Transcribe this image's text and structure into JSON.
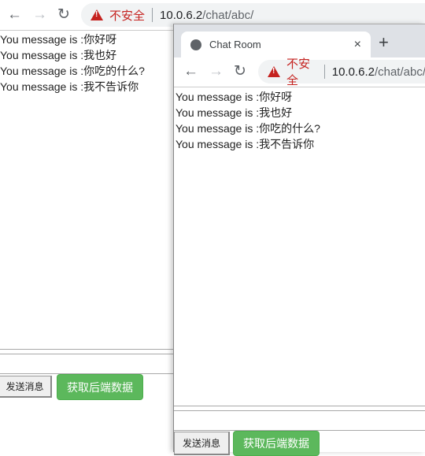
{
  "back_window": {
    "address": {
      "insecure_label": "不安全",
      "host": "10.0.6.2",
      "path": "/chat/abc/"
    },
    "messages": [
      "You message is :你好呀",
      "You message is :我也好",
      "You message is :你吃的什么?",
      "You message is :我不告诉你"
    ],
    "send_button": "发送消息",
    "fetch_button": "获取后端数据"
  },
  "front_window": {
    "tab": {
      "title": "Chat Room",
      "close": "×",
      "new_tab": "+"
    },
    "address": {
      "insecure_label": "不安全",
      "host": "10.0.6.2",
      "path": "/chat/abc/"
    },
    "messages": [
      "You message is :你好呀",
      "You message is :我也好",
      "You message is :你吃的什么?",
      "You message is :我不告诉你"
    ],
    "send_button": "发送消息",
    "fetch_button": "获取后端数据"
  },
  "colors": {
    "accent_green": "#5cb85c",
    "insecure_red": "#c5221f"
  }
}
